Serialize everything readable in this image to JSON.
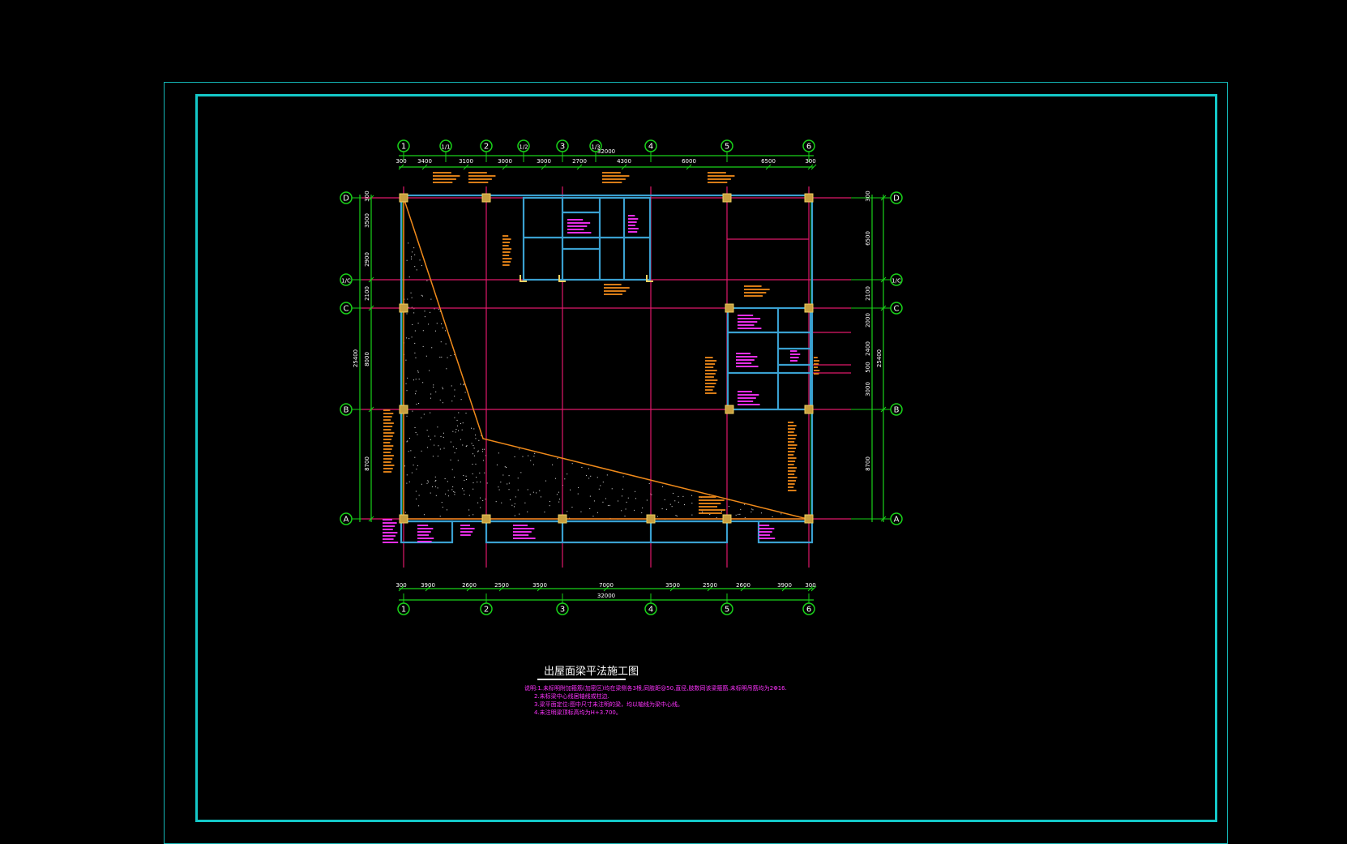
{
  "drawing": {
    "title": "出屋面梁平法施工图",
    "notes": [
      "说明:1.未标明附加箍筋(加密区)均在梁侧各3根,同肢距@50,直径,肢数同该梁箍筋.未标明吊筋均为2Φ16.",
      "2.未标梁中心线居轴线或柱边.",
      "3.梁平面定位:图中尺寸未注明的梁，均以轴线为梁中心线。",
      "4.未注明梁顶标高均为H+3.700。"
    ]
  },
  "grid": {
    "col_labels": [
      "1",
      "1/1",
      "2",
      "1/2",
      "3",
      "1/3",
      "4",
      "5",
      "6"
    ],
    "bottom_col_labels": [
      "1",
      "2",
      "3",
      "4",
      "5",
      "6"
    ],
    "row_labels": [
      "D",
      "1/C",
      "C",
      "B",
      "A"
    ]
  },
  "dimensions": {
    "top_total": "32000",
    "top_segments": [
      "300",
      "3400",
      "3100",
      "3000",
      "3000",
      "2700",
      "4300",
      "6000",
      "6500",
      "300"
    ],
    "bottom_total": "32000",
    "bottom_segments": [
      "300",
      "3900",
      "2600",
      "2500",
      "3500",
      "7000",
      "3500",
      "2500",
      "2600",
      "3900",
      "300"
    ],
    "left_total": "25400",
    "left_segments": [
      "300",
      "3500",
      "2900",
      "2100",
      "8000",
      "8700"
    ],
    "right_total": "25400",
    "right_segments": [
      "300",
      "6500",
      "2100",
      "2000",
      "2400",
      "500",
      "3000",
      "8700"
    ]
  },
  "colors": {
    "background": "#000000",
    "frame": "#14c8c8",
    "grid_line": "#19d219",
    "axis_line": "#e0186a",
    "beam": "#3aa0d0",
    "annotation": "#f08a1a",
    "magenta_text": "#ff33ff",
    "column": "#c8a040",
    "fill_dots": "#e8e8e8"
  }
}
